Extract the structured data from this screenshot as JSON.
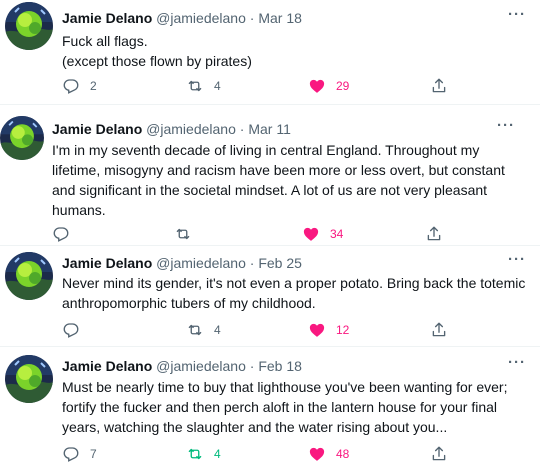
{
  "tweets": [
    {
      "name": "Jamie Delano",
      "handle": "@jamiedelano",
      "date": "Mar 18",
      "text": [
        "Fuck all flags.",
        "(except those flown by pirates)"
      ],
      "replies": "2",
      "retweets": "4",
      "likes": "29",
      "liked": true,
      "retweeted": false
    },
    {
      "name": "Jamie Delano",
      "handle": "@jamiedelano",
      "date": "Mar 11",
      "text": [
        "I'm in my seventh decade of living in central England. Throughout my",
        "lifetime, misogyny and racism have been more or less overt, but constant",
        "and significant in the societal mindset. A lot of us are not very pleasant",
        "humans."
      ],
      "replies": "",
      "retweets": "",
      "likes": "34",
      "liked": true,
      "retweeted": false
    },
    {
      "name": "Jamie Delano",
      "handle": "@jamiedelano",
      "date": "Feb 25",
      "text": [
        "Never mind its gender, it's not even a proper potato. Bring back the totemic",
        "anthropomorphic tubers of my childhood."
      ],
      "replies": "",
      "retweets": "4",
      "likes": "12",
      "liked": true,
      "retweeted": false
    },
    {
      "name": "Jamie Delano",
      "handle": "@jamiedelano",
      "date": "Feb 18",
      "text": [
        "Must be nearly time to buy that lighthouse you've been wanting for ever;",
        "fortify the fucker and then perch aloft in the lantern house for your final",
        "years, watching the slaughter and the water rising about you..."
      ],
      "replies": "7",
      "retweets": "4",
      "likes": "48",
      "liked": true,
      "retweeted": true
    }
  ],
  "ui": {
    "dot": "·",
    "more": "···",
    "icons": [
      "reply-icon",
      "retweet-icon",
      "heart-icon",
      "share-icon"
    ]
  },
  "colors": {
    "like": "#f91880",
    "retweet": "#00ba7c",
    "muted": "#536471"
  }
}
